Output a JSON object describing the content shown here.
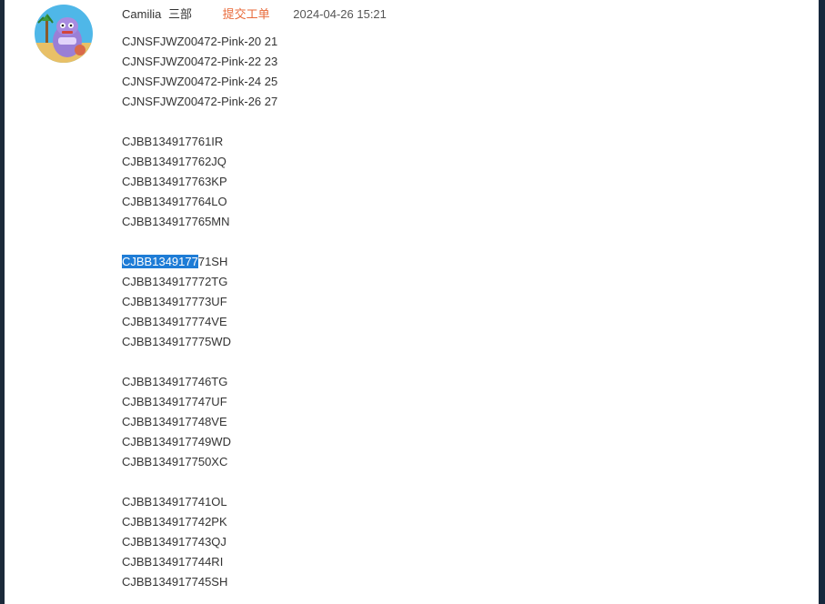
{
  "sender": {
    "name": "Camilia",
    "dept": "三部"
  },
  "ticket_link": "提交工单",
  "timestamp": "2024-04-26 15:21",
  "message": {
    "group1": [
      "CJNSFJWZ00472-Pink-20 21",
      "CJNSFJWZ00472-Pink-22 23",
      "CJNSFJWZ00472-Pink-24 25",
      "CJNSFJWZ00472-Pink-26 27"
    ],
    "group2": [
      "CJBB134917761IR",
      "CJBB134917762JQ",
      "CJBB134917763KP",
      "CJBB134917764LO",
      "CJBB134917765MN"
    ],
    "group3_first_selected": "CJBB1349177",
    "group3_first_rest": "71SH",
    "group3": [
      "CJBB134917772TG",
      "CJBB134917773UF",
      "CJBB134917774VE",
      "CJBB134917775WD"
    ],
    "group4": [
      "CJBB134917746TG",
      "CJBB134917747UF",
      "CJBB134917748VE",
      "CJBB134917749WD",
      "CJBB134917750XC"
    ],
    "group5": [
      "CJBB134917741OL",
      "CJBB134917742PK",
      "CJBB134917743QJ",
      "CJBB134917744RI",
      "CJBB134917745SH"
    ]
  },
  "colors": {
    "ticket_link": "#e86a3a",
    "selection": "#1e7cd6"
  }
}
